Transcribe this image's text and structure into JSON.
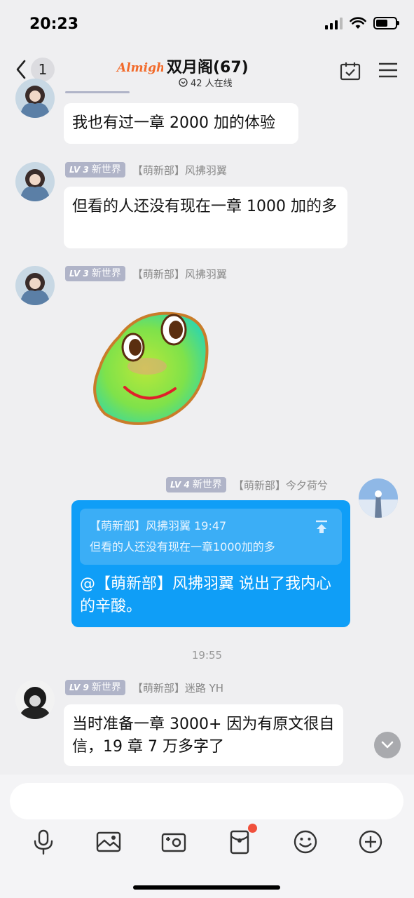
{
  "status": {
    "time": "20:23"
  },
  "header": {
    "back_count": "1",
    "logo_text": "Almighty",
    "title": "双月阁(67)",
    "online": "42 人在线"
  },
  "messages": [
    {
      "text": "我也有过一章 2000 加的体验"
    },
    {
      "level": "LV 3",
      "world": "新世界",
      "sender": "【萌新部】风拂羽翼",
      "text": "但看的人还没有现在一章 1000 加的多"
    },
    {
      "level": "LV 3",
      "world": "新世界",
      "sender": "【萌新部】风拂羽翼",
      "sticker": "green-bean-smile"
    },
    {
      "level": "LV 4",
      "world": "新世界",
      "sender": "【萌新部】今夕荷兮",
      "quote_header": "【萌新部】风拂羽翼 19:47",
      "quote_text": "但看的人还没有现在一章1000加的多",
      "text": "@【萌新部】风拂羽翼 说出了我内心的辛酸。"
    },
    {
      "level": "LV 9",
      "world": "新世界",
      "sender": "【萌新部】迷路 YH",
      "text": "当时准备一章 3000+ 因为有原文很自信，19 章 7 万多字了"
    }
  ],
  "time_separator": "19:55",
  "input": {
    "placeholder": ""
  },
  "toolbar": [
    "mic-icon",
    "image-icon",
    "camera-icon",
    "red-packet-icon",
    "emoji-icon",
    "plus-icon"
  ],
  "colors": {
    "accent": "#0f9ef7",
    "badge": "#b0b4c8",
    "notify": "#f0503c"
  }
}
